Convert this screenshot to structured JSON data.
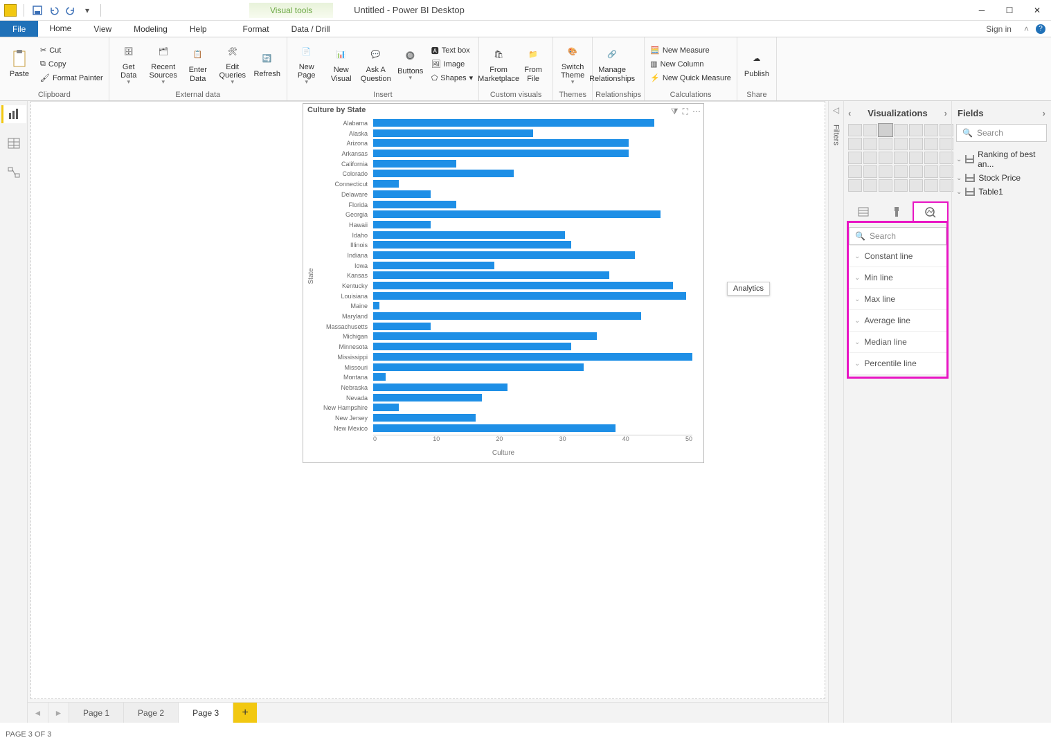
{
  "title": "Untitled - Power BI Desktop",
  "visual_tools_label": "Visual tools",
  "menubar": {
    "file": "File",
    "home": "Home",
    "view": "View",
    "modeling": "Modeling",
    "help": "Help",
    "format": "Format",
    "datadrill": "Data / Drill",
    "signin": "Sign in"
  },
  "ribbon": {
    "clipboard": {
      "label": "Clipboard",
      "paste": "Paste",
      "cut": "Cut",
      "copy": "Copy",
      "format_painter": "Format Painter"
    },
    "external": {
      "label": "External data",
      "get_data": "Get Data",
      "recent": "Recent Sources",
      "enter": "Enter Data",
      "edit": "Edit Queries",
      "refresh": "Refresh"
    },
    "insert": {
      "label": "Insert",
      "new_page": "New Page",
      "new_visual": "New Visual",
      "ask": "Ask A Question",
      "buttons": "Buttons",
      "textbox": "Text box",
      "image": "Image",
      "shapes": "Shapes"
    },
    "custom": {
      "label": "Custom visuals",
      "marketplace": "From Marketplace",
      "file": "From File"
    },
    "themes": {
      "label": "Themes",
      "switch": "Switch Theme"
    },
    "rel": {
      "label": "Relationships",
      "manage": "Manage Relationships"
    },
    "calc": {
      "label": "Calculations",
      "new_measure": "New Measure",
      "new_column": "New Column",
      "new_quick": "New Quick Measure"
    },
    "share": {
      "label": "Share",
      "publish": "Publish"
    }
  },
  "filters_label": "Filters",
  "viz_header": "Visualizations",
  "fields_header": "Fields",
  "search_placeholder": "Search",
  "analytics_tooltip": "Analytics",
  "analytics_items": [
    "Constant line",
    "Min line",
    "Max line",
    "Average line",
    "Median line",
    "Percentile line"
  ],
  "fields_tables": [
    "Ranking of best an...",
    "Stock Price",
    "Table1"
  ],
  "pages": [
    "Page 1",
    "Page 2",
    "Page 3"
  ],
  "status": "PAGE 3 OF 3",
  "chart_data": {
    "type": "bar",
    "title": "Culture by State",
    "xlabel": "Culture",
    "ylabel": "State",
    "xlim": [
      0,
      50
    ],
    "xticks": [
      0,
      10,
      20,
      30,
      40,
      50
    ],
    "categories": [
      "Alabama",
      "Alaska",
      "Arizona",
      "Arkansas",
      "California",
      "Colorado",
      "Connecticut",
      "Delaware",
      "Florida",
      "Georgia",
      "Hawaii",
      "Idaho",
      "Illinois",
      "Indiana",
      "Iowa",
      "Kansas",
      "Kentucky",
      "Louisiana",
      "Maine",
      "Maryland",
      "Massachusetts",
      "Michigan",
      "Minnesota",
      "Mississippi",
      "Missouri",
      "Montana",
      "Nebraska",
      "Nevada",
      "New Hampshire",
      "New Jersey",
      "New Mexico"
    ],
    "values": [
      44,
      25,
      40,
      40,
      13,
      22,
      4,
      9,
      13,
      45,
      9,
      30,
      31,
      41,
      19,
      37,
      47,
      49,
      1,
      42,
      9,
      35,
      31,
      50,
      33,
      2,
      21,
      17,
      4,
      16,
      38
    ]
  }
}
